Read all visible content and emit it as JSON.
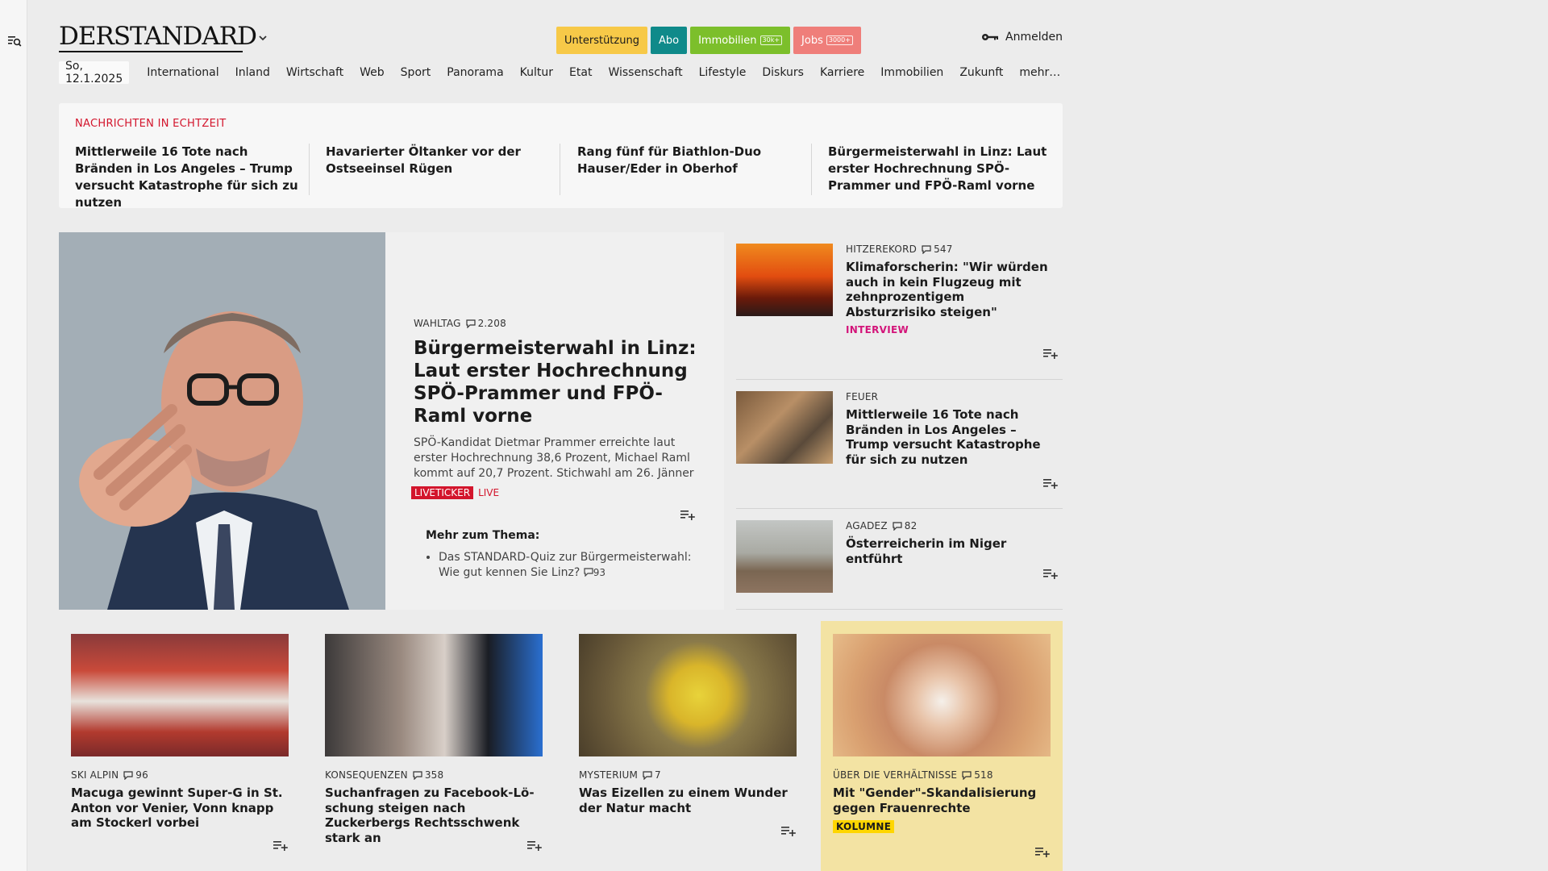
{
  "header": {
    "logo": "DERSTANDARD",
    "pills": [
      {
        "label": "Unterstützung",
        "count": "",
        "bg": "#f7c948",
        "fg": "#1b1b1b"
      },
      {
        "label": "Abo",
        "count": "",
        "bg": "#0f8a8a",
        "fg": "#ffffff"
      },
      {
        "label": "Immobilien",
        "count": "30k+",
        "bg": "#7cbf2b",
        "fg": "#ffffff"
      },
      {
        "label": "Jobs",
        "count": "3000+",
        "bg": "#ef7e7a",
        "fg": "#ffffff"
      }
    ],
    "login_label": "Anmelden"
  },
  "nav": {
    "date": "So, 12.1.2025",
    "items": [
      "International",
      "Inland",
      "Wirtschaft",
      "Web",
      "Sport",
      "Panorama",
      "Kultur",
      "Etat",
      "Wissenschaft",
      "Lifestyle",
      "Diskurs",
      "Karriere",
      "Immobilien",
      "Zukunft",
      "mehr…"
    ]
  },
  "ticker": {
    "label": "NACHRICHTEN IN ECHTZEIT",
    "items": [
      "Mittlerweile 16 Tote nach Bränden in Los Angeles – Trump versucht Kata­strophe für sich zu nutzen",
      "Havarierter Öltanker vor der Ostsee­insel Rügen",
      "Rang fünf für Biathlon-Duo Hauser/Eder in Oberhof",
      "Bürgermeisterwahl in Linz: Laut erster Hochrechnung SPÖ-Prammer und FPÖ-Raml vorne"
    ]
  },
  "hero": {
    "kicker": "WAHLTAG",
    "comments": "2.208",
    "title": "Bürgermeisterwahl in Linz: Laut erster Hochrechnung SPÖ-Prammer und FPÖ-Raml vorne",
    "lead": "SPÖ-Kandidat Dietmar Prammer erreichte laut erster Hochrechnung 38,6 Prozent, Michael Raml kommt auf 20,7 Prozent. Stichwahl am 26. Jänner",
    "badge": "LIVETICKER",
    "live": "LIVE",
    "more_heading": "Mehr zum Thema:",
    "more_item": "Das STANDARD-Quiz zur Bürgermeisterwahl: Wie gut kennen Sie Linz?",
    "more_comments": "93"
  },
  "side": [
    {
      "kicker": "HITZEREKORD",
      "comments": "547",
      "title": "Klimaforscherin: \"Wir würden auch in kein Flugzeug mit zehn­prozentigem Absturzrisiko steigen\"",
      "tag": "INTERVIEW"
    },
    {
      "kicker": "FEUER",
      "comments": "",
      "title": "Mittlerweile 16 Tote nach Bränden in Los Angeles – Trump versucht Katastrophe für sich zu nutzen",
      "tag": ""
    },
    {
      "kicker": "AGADEZ",
      "comments": "82",
      "title": "Österreicherin im Niger entführt",
      "tag": ""
    }
  ],
  "cards": [
    {
      "kicker": "SKI ALPIN",
      "comments": "96",
      "title": "Macuga gewinnt Super-G in St. Anton vor Venier, Vonn knapp am Stockerl vorbei",
      "tag": ""
    },
    {
      "kicker": "KONSEQUENZEN",
      "comments": "358",
      "title": "Suchanfragen zu Facebook-Lö­schung steigen nach Zuckerbergs Rechtsschwenk stark an",
      "tag": ""
    },
    {
      "kicker": "MYSTERIUM",
      "comments": "7",
      "title": "Was Eizellen zu einem Wunder der Natur macht",
      "tag": ""
    },
    {
      "kicker": "ÜBER DIE VERHÄLTNISSE",
      "comments": "518",
      "title": "Mit \"Gender\"-Skandalisierung gegen Frauenrechte",
      "tag": "KOLUMNE"
    }
  ],
  "colors": {
    "accent_red": "#d3152c",
    "accent_pink": "#d3157a",
    "column_yellow": "#f3e3a3",
    "tag_yellow": "#ffd600"
  }
}
